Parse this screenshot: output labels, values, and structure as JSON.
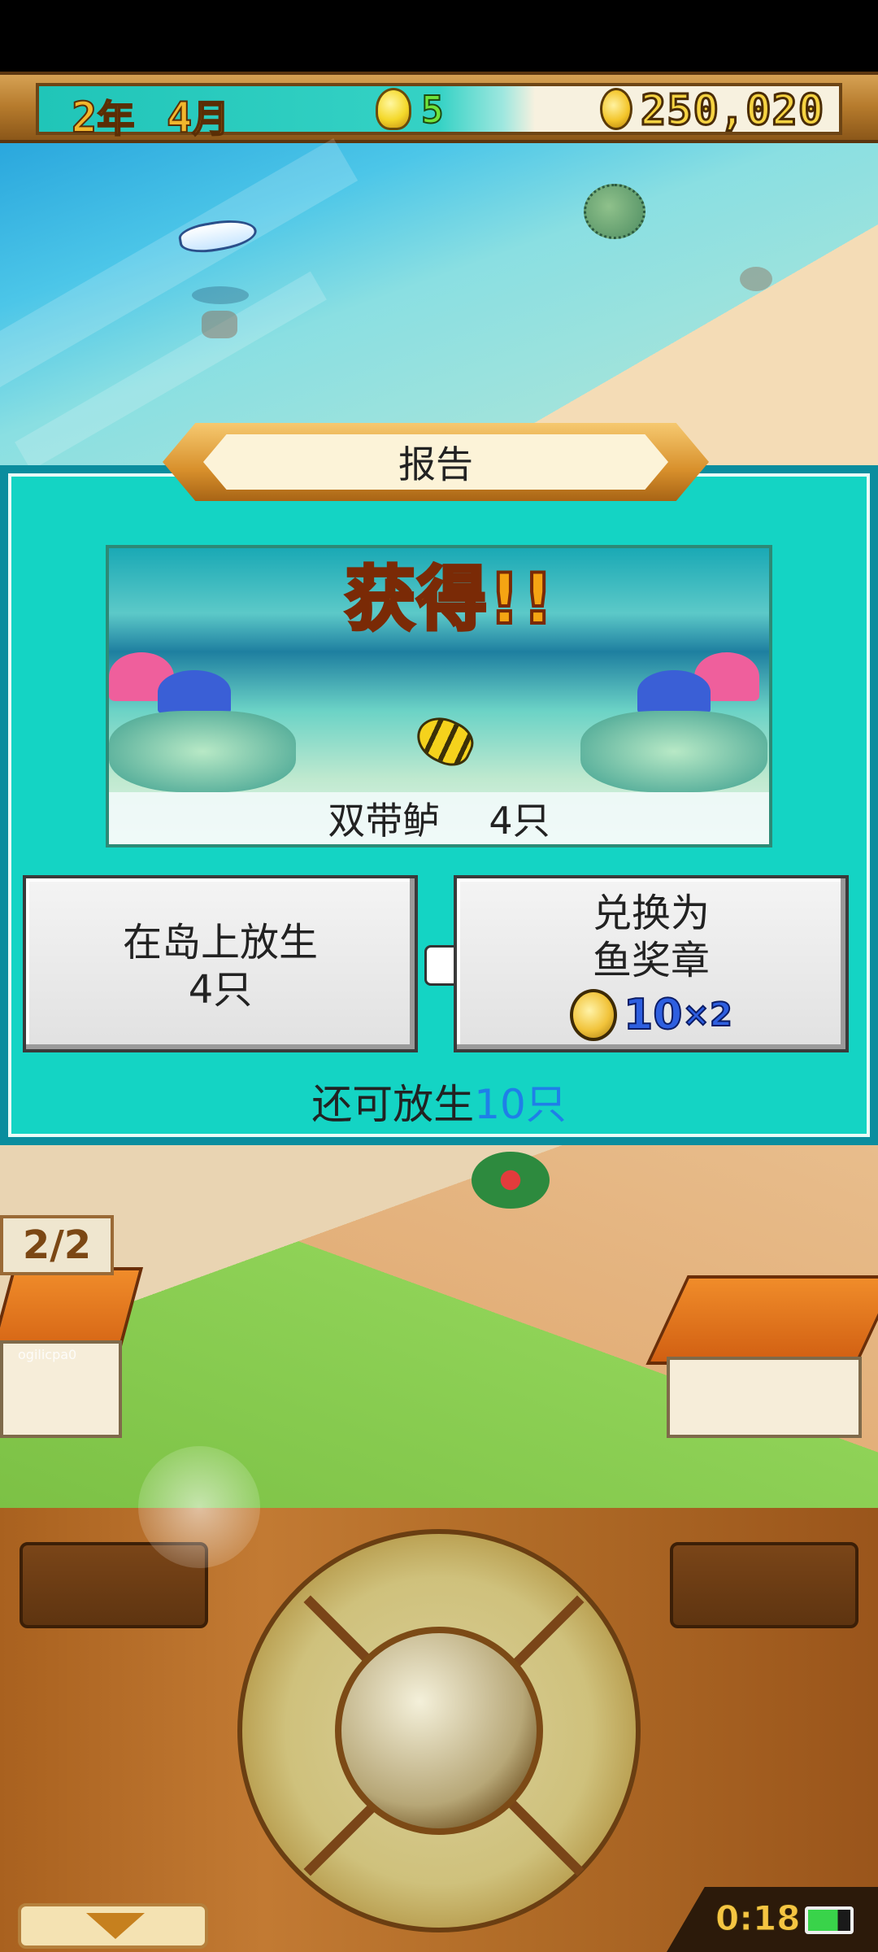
{
  "status_bar": {
    "year": "2",
    "year_unit": "年",
    "month": "4",
    "month_unit": "月",
    "ideas": "5",
    "money": "250,020",
    "bulb_icon": "lightbulb-icon",
    "coin_icon": "coin-icon"
  },
  "report": {
    "title": "报告",
    "obtain_label": "获得!!",
    "catch_name": "双带鲈",
    "catch_count": "4只",
    "release_button": {
      "line1": "在岛上放生",
      "line2": "4只"
    },
    "exchange_button": {
      "line1": "兑换为",
      "line2": "鱼奖章",
      "medal_value": "10",
      "medal_multiplier": "×2"
    },
    "remaining_prefix": "还可放生",
    "remaining_value": "10只"
  },
  "island": {
    "counter": "2/2",
    "overlay_text": "ogilicpa0"
  },
  "controls": {
    "timer": "0:18"
  },
  "colors": {
    "panel_teal": "#14d4c4",
    "remaining_blue": "#1f7fe8",
    "wood": "#b06b27"
  }
}
